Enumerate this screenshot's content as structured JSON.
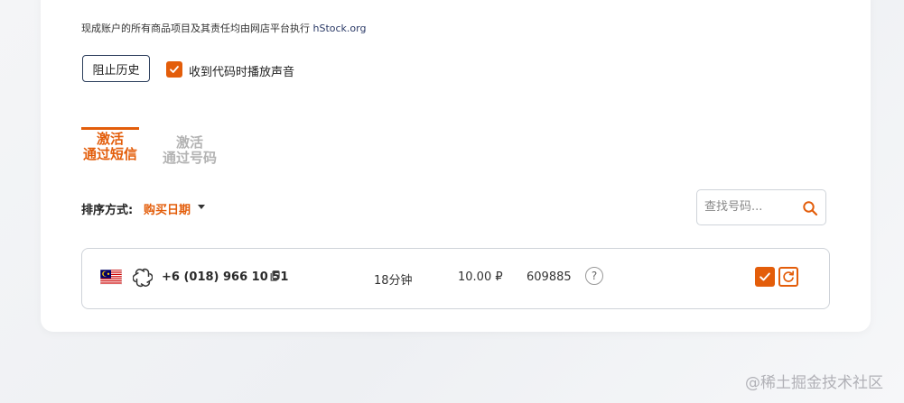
{
  "header": {
    "notice_text": "现成账户的所有商品项目及其责任均由网店平台执行",
    "notice_link": "hStock.org"
  },
  "controls": {
    "block_history_label": "阻止历史",
    "sound_checkbox_label": "收到代码时播放声音",
    "sound_checked": true
  },
  "tabs": [
    {
      "line1": "激活",
      "line2": "通过短信",
      "active": true
    },
    {
      "line1": "激活",
      "line2": "通过号码",
      "active": false
    }
  ],
  "sort": {
    "label": "排序方式:",
    "value": "购买日期"
  },
  "search": {
    "placeholder": "查找号码..."
  },
  "numbers": [
    {
      "country_flag": "malaysia-flag",
      "service_icon": "openai-icon",
      "phone": "+6 (018) 966 10 51",
      "duration": "18分钟",
      "price": "10.00 ₽",
      "code": "609885",
      "help": "?"
    }
  ],
  "watermark": "@稀土掘金技术社区",
  "colors": {
    "accent": "#e35d0a",
    "inactive_tab": "#b3b3b3",
    "border": "#cfd3d9"
  }
}
